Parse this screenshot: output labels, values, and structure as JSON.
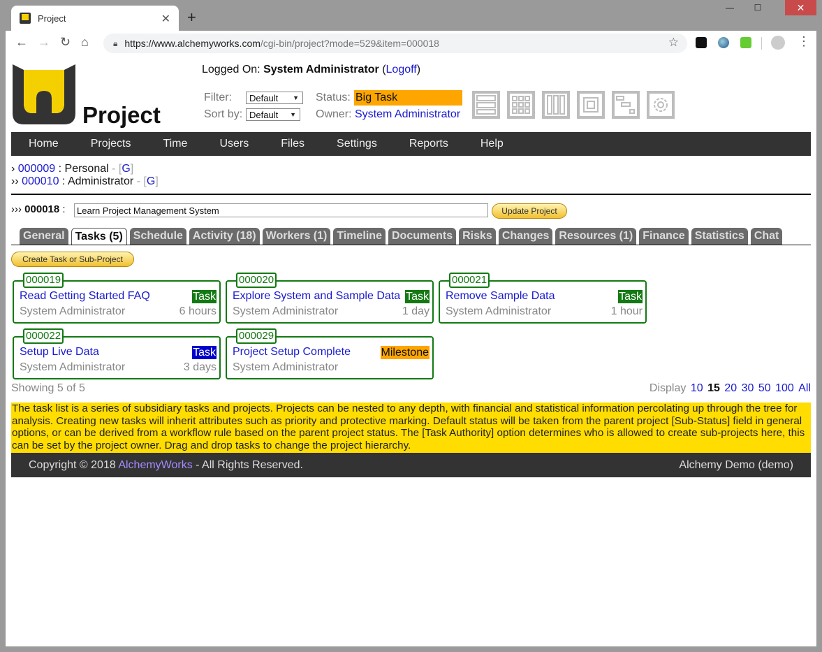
{
  "browser": {
    "tab_title": "Project",
    "url_host": "https://www.alchemyworks.com",
    "url_path": "/cgi-bin/project?mode=529&item=000018"
  },
  "header": {
    "app_title": "Project",
    "logged_on_label": "Logged On:",
    "user": "System Administrator",
    "logoff": "Logoff",
    "filter_label": "Filter:",
    "filter_value": "Default",
    "sort_label": "Sort by:",
    "sort_value": "Default",
    "status_label": "Status:",
    "status_value": "Big Task",
    "owner_label": "Owner:",
    "owner_value": "System Administrator",
    "view_icons": [
      "list-view-icon",
      "grid-view-icon",
      "column-view-icon",
      "box-view-icon",
      "gantt-view-icon",
      "settings-view-icon"
    ]
  },
  "nav": [
    "Home",
    "Projects",
    "Time",
    "Users",
    "Files",
    "Settings",
    "Reports",
    "Help"
  ],
  "breadcrumbs": [
    {
      "prefix": "›",
      "id": "000009",
      "name": "Personal",
      "g": "G"
    },
    {
      "prefix": "››",
      "id": "000010",
      "name": "Administrator",
      "g": "G"
    }
  ],
  "item": {
    "prefix": "›››",
    "id": "000018",
    "title": "Learn Project Management System",
    "update_button": "Update Project"
  },
  "tabs": [
    "General",
    "Tasks (5)",
    "Schedule",
    "Activity (18)",
    "Workers (1)",
    "Timeline",
    "Documents",
    "Risks",
    "Changes",
    "Resources (1)",
    "Finance",
    "Statistics",
    "Chat"
  ],
  "active_tab": "Tasks (5)",
  "create_button": "Create Task or Sub-Project",
  "tasks": [
    {
      "id": "000019",
      "title": "Read Getting Started FAQ",
      "type": "Task",
      "type_color": "#137a13",
      "owner": "System Administrator",
      "duration": "6 hours"
    },
    {
      "id": "000020",
      "title": "Explore System and Sample Data",
      "type": "Task",
      "type_color": "#137a13",
      "owner": "System Administrator",
      "duration": "1 day"
    },
    {
      "id": "000021",
      "title": "Remove Sample Data",
      "type": "Task",
      "type_color": "#137a13",
      "owner": "System Administrator",
      "duration": "1 hour"
    },
    {
      "id": "000022",
      "title": "Setup Live Data",
      "type": "Task",
      "type_color": "#0000cc",
      "owner": "System Administrator",
      "duration": "3 days"
    },
    {
      "id": "000029",
      "title": "Project Setup Complete",
      "type": "Milestone",
      "type_color": "#ffa500",
      "owner": "System Administrator",
      "duration": ""
    }
  ],
  "showing": "Showing 5 of 5",
  "display": {
    "label": "Display",
    "options": [
      "10",
      "15",
      "20",
      "30",
      "50",
      "100",
      "All"
    ],
    "selected": "15"
  },
  "help_text": "The task list is a series of subsidiary tasks and projects. Projects can be nested to any depth, with financial and statistical information percolating up through the tree for analysis. Creating new tasks will inherit attributes such as priority and protective marking. Default status will be taken from the parent project [Sub-Status] field in general options, or can be derived from a workflow rule based on the parent project status. The [Task Authority] option determines who is allowed to create sub-projects here, this can be set by the project owner. Drag and drop tasks to change the project hierarchy.",
  "footer": {
    "copyright_prefix": "Copyright © 2018 ",
    "company": "AlchemyWorks",
    "copyright_suffix": " - All Rights Reserved.",
    "right": "Alchemy Demo (demo)"
  }
}
